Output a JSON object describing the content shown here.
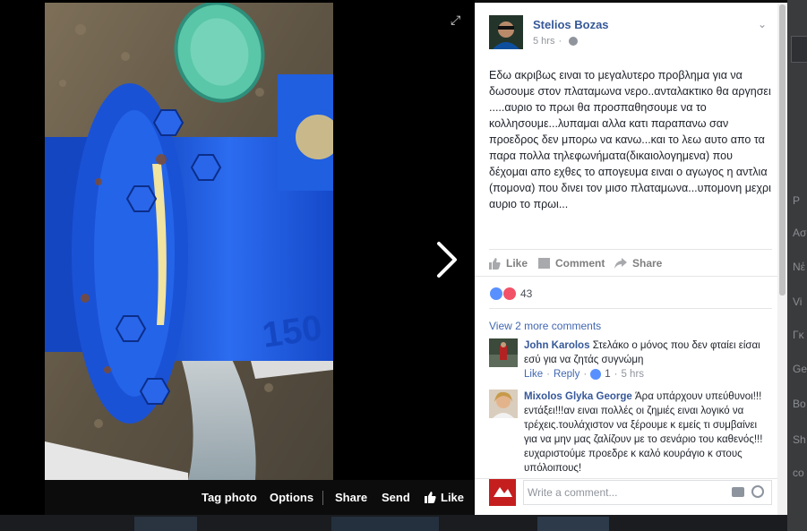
{
  "photo_viewer": {
    "actions": {
      "tag_photo": "Tag photo",
      "options": "Options",
      "share": "Share",
      "send": "Send",
      "like": "Like"
    },
    "icons": [
      "expand-icon",
      "next-arrow-icon",
      "like-thumb-icon"
    ]
  },
  "post": {
    "author": "Stelios Bozas",
    "time": "5 hrs",
    "privacy_icon": "globe-icon",
    "text": "Εδω ακριβως ειναι το μεγαλυτερο προβλημα για να δωσουμε στον πλαταμωνα νερο..ανταλακτικο θα αργησει .....αυριο το πρωι θα προσπαθησουμε να το κολλησουμε...λυπαμαι αλλα κατι παραπανω σαν προεδρος δεν μπορω να κανω...και το λεω αυτο απο τα παρα πολλα τηλεφωνήματα(δικαιολογημενα) που δέχομαι απο εχθες το απογευμα ειναι ο αγωγος η αντλια (πομονα) που δινει τον μισο πλαταμωνα...υπομονη μεχρι αυριο το πρωι...",
    "actions": {
      "like": "Like",
      "comment": "Comment",
      "share": "Share"
    },
    "reactions": {
      "count": "43",
      "types": [
        "like",
        "love"
      ]
    }
  },
  "comments": {
    "view_more": "View 2 more comments",
    "items": [
      {
        "name": "John Karolos",
        "text": "Στελάκο ο μόνος που δεν φταίει είσαι εσύ για να ζητάς συγνώμη",
        "like": "Like",
        "reply": "Reply",
        "likes": "1",
        "time": "5 hrs"
      },
      {
        "name": "Mixolos Glyka George",
        "text": "Άρα υπάρχουν υπεύθυνοι!!!εντάξει!!!αν ειναι πολλές οι ζημιές ειναι λογικό να τρέχεις.τουλάχιστον να ξέρουμε κ εμείς τι συμβαίνει για να μην μας ζαλίζουν με το σενάριο του καθενός!!!ευχαριστούμε προεδρε κ καλό κουράγιο κ στους υπόλοιπους!"
      }
    ],
    "input_placeholder": "Write a comment..."
  },
  "background_page": {
    "visible_fragments": [
      "P",
      "Ασ",
      "Νέ",
      "Vi",
      "Γκ",
      "Ge",
      "Bo",
      "Sh",
      "co"
    ]
  }
}
